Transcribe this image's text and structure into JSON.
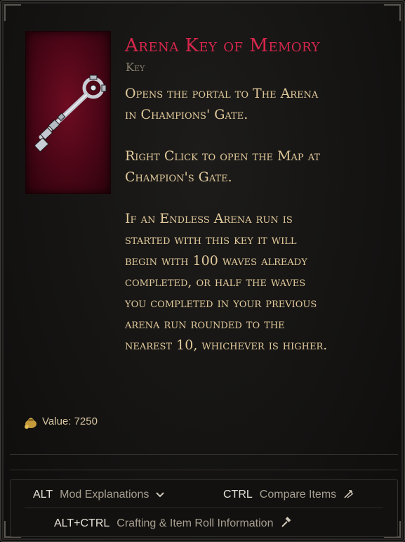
{
  "item": {
    "name": "Arena Key of Memory",
    "type": "Key",
    "rarity_color": "#d8264c",
    "icon": "key-icon"
  },
  "description": {
    "p1": [
      "Opens the portal to The Arena",
      "in Champions' Gate."
    ],
    "p2": [
      "Right Click to open the Map at",
      "Champion's Gate."
    ],
    "p3": [
      "If an Endless Arena run is",
      "started with this key it will",
      "begin with 100 waves already",
      "completed, or half the waves",
      "you completed in your previous",
      "arena run rounded to the",
      "nearest 10, whichever is higher."
    ]
  },
  "value": {
    "label": "Value: 7250",
    "icon": "gold-bag-icon"
  },
  "footer": {
    "alt_key": "ALT",
    "alt_hint": "Mod Explanations",
    "alt_icon": "chevron-down-icon",
    "ctrl_key": "CTRL",
    "ctrl_hint": "Compare Items",
    "ctrl_icon": "compare-arrows-icon",
    "altctrl_key": "ALT+CTRL",
    "altctrl_hint": "Crafting & Item Roll Information",
    "altctrl_icon": "hammer-icon"
  }
}
